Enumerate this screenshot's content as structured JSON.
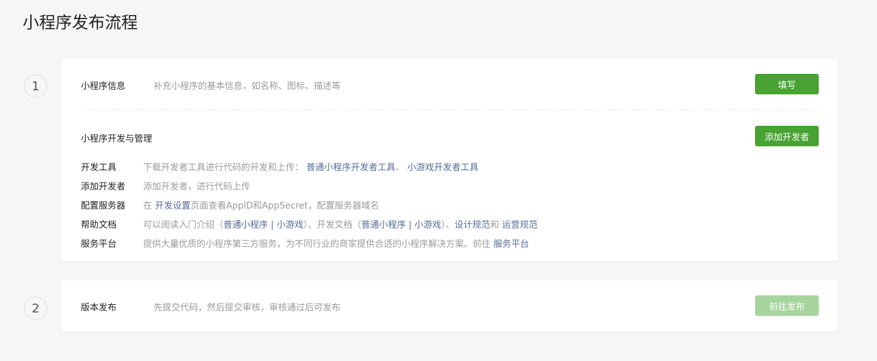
{
  "page": {
    "title": "小程序发布流程"
  },
  "steps": [
    {
      "number": "1"
    },
    {
      "number": "2"
    }
  ],
  "info": {
    "label": "小程序信息",
    "desc": "补充小程序的基本信息，如名称、图标、描述等",
    "button": "填写"
  },
  "dev": {
    "title": "小程序开发与管理",
    "button": "添加开发者",
    "tools": {
      "label": "开发工具",
      "text": "下载开发者工具进行代码的开发和上传：",
      "link1": "普通小程序开发者工具",
      "sep": "、",
      "link2": "小游戏开发者工具"
    },
    "developers": {
      "label": "添加开发者",
      "text": "添加开发者，进行代码上传"
    },
    "server": {
      "label": "配置服务器",
      "prefix": "在 ",
      "link": "开发设置",
      "suffix": "页面查看AppID和AppSecret，配置服务器域名"
    },
    "docs": {
      "label": "帮助文档",
      "text1": "可以阅读入门介绍（",
      "link1": "普通小程序",
      "pipe1": " | ",
      "link2": "小游戏",
      "text2": "）、开发文档（",
      "link3": "普通小程序",
      "pipe2": " | ",
      "link4": "小游戏",
      "text3": "）、",
      "link5": "设计规范",
      "text4": "和 ",
      "link6": "运营规范"
    },
    "platform": {
      "label": "服务平台",
      "text": "提供大量优质的小程序第三方服务，为不同行业的商家提供合适的小程序解决方案。前往 ",
      "link": "服务平台"
    }
  },
  "publish": {
    "label": "版本发布",
    "desc": "先提交代码，然后提交审核，审核通过后可发布",
    "button": "前往发布"
  },
  "colors": {
    "primary": "#48a332",
    "primary_disabled": "#a7d59d",
    "link": "#576b95",
    "background": "#f6f6f6"
  }
}
